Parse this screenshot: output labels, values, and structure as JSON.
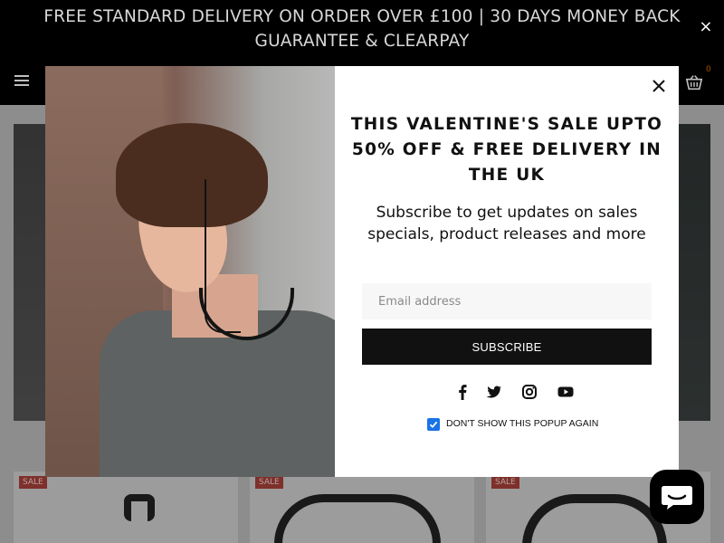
{
  "announcement": {
    "text_line1": "FREE STANDARD DELIVERY ON ORDER OVER £100 | 30 DAYS MONEY BACK",
    "text_line2": "GUARANTEE & CLEARPAY"
  },
  "header": {
    "cart_count": "0"
  },
  "products": [
    {
      "badge": "SALE"
    },
    {
      "badge": "SALE"
    },
    {
      "badge": "SALE"
    }
  ],
  "popup": {
    "headline": "THIS VALENTINE'S SALE UPTO 50% OFF & FREE DELIVERY IN THE UK",
    "subtext": "Subscribe to get updates on sales specials, product releases and more",
    "email_placeholder": "Email address",
    "subscribe_label": "SUBSCRIBE",
    "dont_show_label": "DON'T SHOW THIS POPUP AGAIN",
    "dont_show_checked": true,
    "social_icons": [
      "facebook-icon",
      "twitter-icon",
      "instagram-icon",
      "youtube-icon"
    ]
  },
  "icons": [
    "menu-icon",
    "cart-icon",
    "close-icon",
    "chat-icon"
  ],
  "colors": {
    "announcement_bg": "#000000",
    "primary_button": "#111111",
    "sale_badge": "#a8403a",
    "checkbox": "#1a73e8",
    "cart_count": "#e06a00"
  }
}
